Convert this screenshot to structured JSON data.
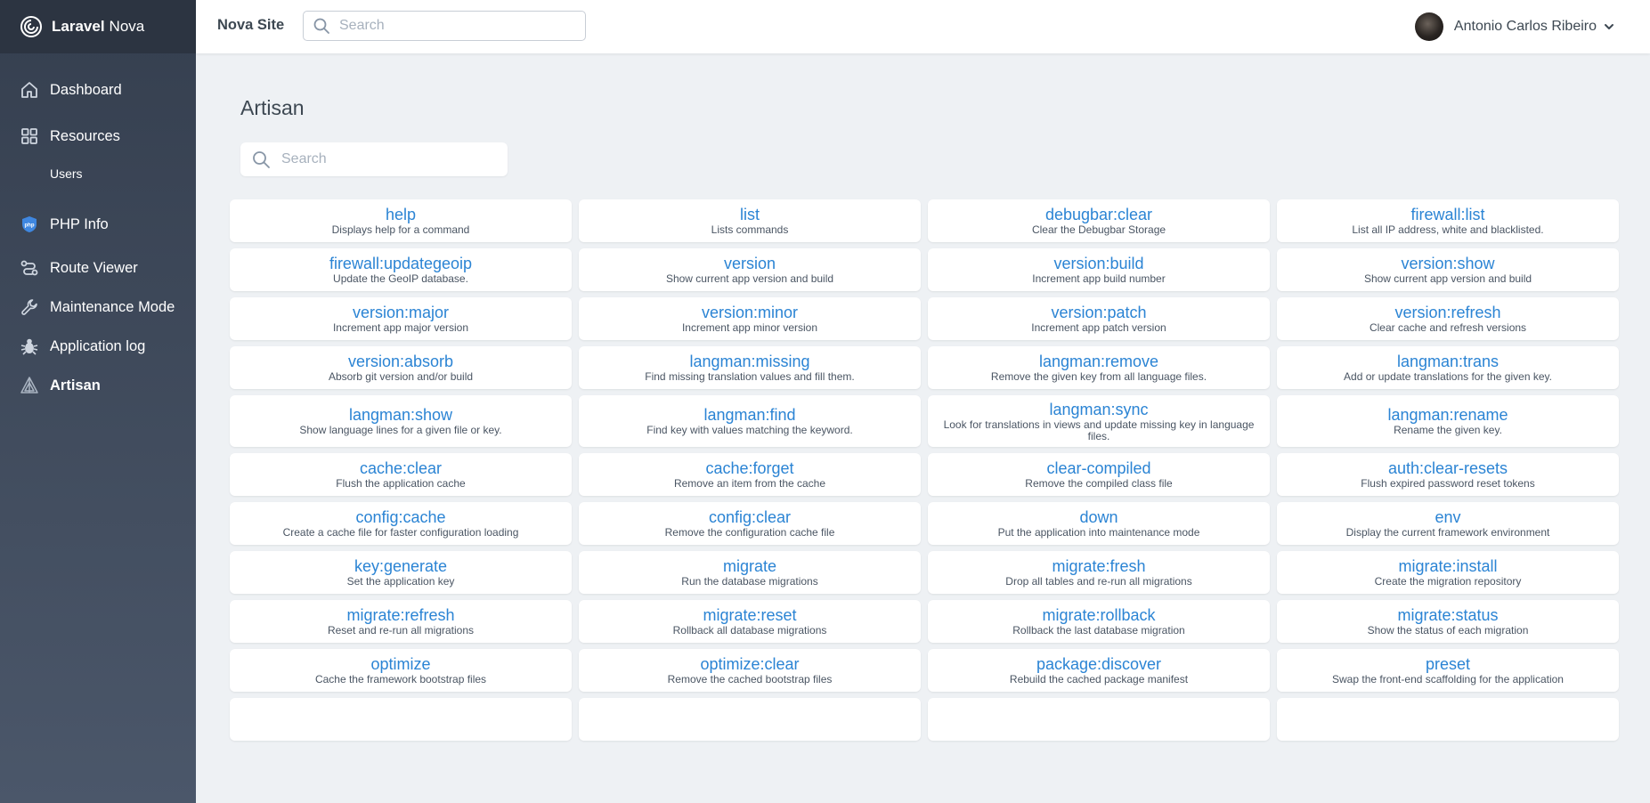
{
  "brand": {
    "bold": "Laravel",
    "rest": "Nova"
  },
  "sidebar": {
    "items": [
      {
        "label": "Dashboard",
        "icon": "home-icon"
      },
      {
        "label": "Resources",
        "icon": "grid-icon"
      },
      {
        "label": "Users",
        "icon": ""
      },
      {
        "label": "PHP Info",
        "icon": "php-icon"
      },
      {
        "label": "Route Viewer",
        "icon": "route-icon"
      },
      {
        "label": "Maintenance Mode",
        "icon": "wrench-icon"
      },
      {
        "label": "Application log",
        "icon": "bug-icon"
      },
      {
        "label": "Artisan",
        "icon": "artisan-icon"
      }
    ]
  },
  "header": {
    "site_name": "Nova Site",
    "search_placeholder": "Search",
    "user_name": "Antonio Carlos Ribeiro"
  },
  "page": {
    "title": "Artisan",
    "search_placeholder": "Search"
  },
  "commands": [
    {
      "name": "help",
      "desc": "Displays help for a command"
    },
    {
      "name": "list",
      "desc": "Lists commands"
    },
    {
      "name": "debugbar:clear",
      "desc": "Clear the Debugbar Storage"
    },
    {
      "name": "firewall:list",
      "desc": "List all IP address, white and blacklisted."
    },
    {
      "name": "firewall:updategeoip",
      "desc": "Update the GeoIP database."
    },
    {
      "name": "version",
      "desc": "Show current app version and build"
    },
    {
      "name": "version:build",
      "desc": "Increment app build number"
    },
    {
      "name": "version:show",
      "desc": "Show current app version and build"
    },
    {
      "name": "version:major",
      "desc": "Increment app major version"
    },
    {
      "name": "version:minor",
      "desc": "Increment app minor version"
    },
    {
      "name": "version:patch",
      "desc": "Increment app patch version"
    },
    {
      "name": "version:refresh",
      "desc": "Clear cache and refresh versions"
    },
    {
      "name": "version:absorb",
      "desc": "Absorb git version and/or build"
    },
    {
      "name": "langman:missing",
      "desc": "Find missing translation values and fill them."
    },
    {
      "name": "langman:remove",
      "desc": "Remove the given key from all language files."
    },
    {
      "name": "langman:trans",
      "desc": "Add or update translations for the given key."
    },
    {
      "name": "langman:show",
      "desc": "Show language lines for a given file or key."
    },
    {
      "name": "langman:find",
      "desc": "Find key with values matching the keyword."
    },
    {
      "name": "langman:sync",
      "desc": "Look for translations in views and update missing key in language files."
    },
    {
      "name": "langman:rename",
      "desc": "Rename the given key."
    },
    {
      "name": "cache:clear",
      "desc": "Flush the application cache"
    },
    {
      "name": "cache:forget",
      "desc": "Remove an item from the cache"
    },
    {
      "name": "clear-compiled",
      "desc": "Remove the compiled class file"
    },
    {
      "name": "auth:clear-resets",
      "desc": "Flush expired password reset tokens"
    },
    {
      "name": "config:cache",
      "desc": "Create a cache file for faster configuration loading"
    },
    {
      "name": "config:clear",
      "desc": "Remove the configuration cache file"
    },
    {
      "name": "down",
      "desc": "Put the application into maintenance mode"
    },
    {
      "name": "env",
      "desc": "Display the current framework environment"
    },
    {
      "name": "key:generate",
      "desc": "Set the application key"
    },
    {
      "name": "migrate",
      "desc": "Run the database migrations"
    },
    {
      "name": "migrate:fresh",
      "desc": "Drop all tables and re-run all migrations"
    },
    {
      "name": "migrate:install",
      "desc": "Create the migration repository"
    },
    {
      "name": "migrate:refresh",
      "desc": "Reset and re-run all migrations"
    },
    {
      "name": "migrate:reset",
      "desc": "Rollback all database migrations"
    },
    {
      "name": "migrate:rollback",
      "desc": "Rollback the last database migration"
    },
    {
      "name": "migrate:status",
      "desc": "Show the status of each migration"
    },
    {
      "name": "optimize",
      "desc": "Cache the framework bootstrap files"
    },
    {
      "name": "optimize:clear",
      "desc": "Remove the cached bootstrap files"
    },
    {
      "name": "package:discover",
      "desc": "Rebuild the cached package manifest"
    },
    {
      "name": "preset",
      "desc": "Swap the front-end scaffolding for the application"
    },
    {
      "name": "",
      "desc": ""
    },
    {
      "name": "",
      "desc": ""
    },
    {
      "name": "",
      "desc": ""
    },
    {
      "name": "",
      "desc": ""
    }
  ],
  "colors": {
    "accent": "#2b84d4",
    "sidebar_top": "#353f4f",
    "sidebar_bottom": "#4b576a",
    "brand_bar": "#2c3441",
    "page_bg": "#eef1f4"
  }
}
